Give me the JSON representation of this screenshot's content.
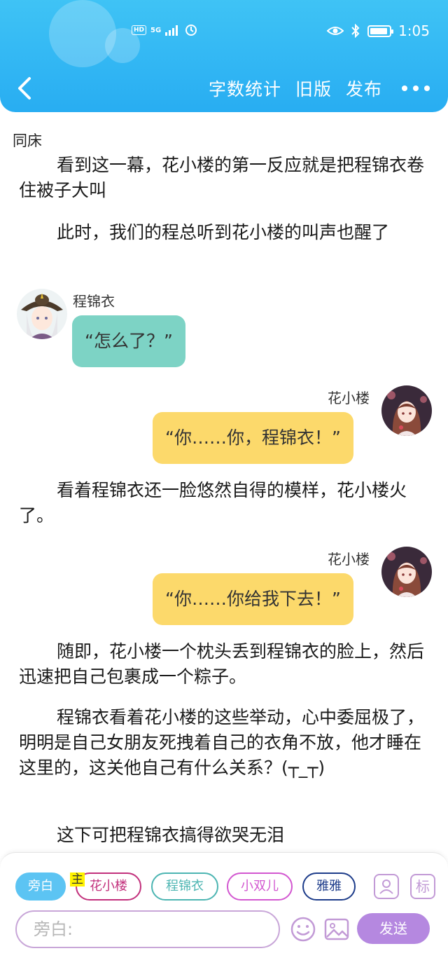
{
  "status_bar": {
    "left_badge": "HD",
    "network": "5G",
    "time": "1:05"
  },
  "nav": {
    "actions": [
      "字数统计",
      "旧版",
      "发布"
    ]
  },
  "story": {
    "title": "同床",
    "blocks": [
      {
        "type": "para",
        "text": "看到这一幕，花小楼的第一反应就是把程锦衣卷住被子大叫"
      },
      {
        "type": "para",
        "text": "此时，我们的程总听到花小楼的叫声也醒了"
      },
      {
        "type": "dialog",
        "side": "left",
        "speaker": "程锦衣",
        "text": "“怎么了？”",
        "color": "#7dd3c5"
      },
      {
        "type": "dialog",
        "side": "right",
        "speaker": "花小楼",
        "text": "“你……你，程锦衣！”",
        "color": "#fcd96b"
      },
      {
        "type": "para",
        "text": "看着程锦衣还一脸悠然自得的模样，花小楼火了。"
      },
      {
        "type": "dialog",
        "side": "right",
        "speaker": "花小楼",
        "text": "“你……你给我下去！”",
        "color": "#fcd96b"
      },
      {
        "type": "para",
        "text": "随即，花小楼一个枕头丢到程锦衣的脸上，然后迅速把自己包裹成一个粽子。"
      },
      {
        "type": "para",
        "text": "程锦衣看着花小楼的这些举动，心中委屈极了，明明是自己女朋友死拽着自己的衣角不放，他才睡在这里的，这关他自己有什么关系？(┬_┬)"
      },
      {
        "type": "para",
        "text": "这下可把程锦衣搞得欲哭无泪"
      }
    ]
  },
  "toolbar": {
    "roles": [
      {
        "label": "旁白",
        "selected": true
      },
      {
        "label": "花小楼",
        "color": "#c2307c"
      },
      {
        "label": "程锦衣",
        "color": "#4cb5b2"
      },
      {
        "label": "小双儿",
        "color": "#d257d0"
      },
      {
        "label": "雅雅",
        "color": "#1d3c8a"
      }
    ],
    "main_tag": "主",
    "tag_icon": "标",
    "input_placeholder": "旁白:",
    "send_label": "发送"
  },
  "colors": {
    "header": "#28adf2",
    "accent_purple": "#b588e0"
  }
}
